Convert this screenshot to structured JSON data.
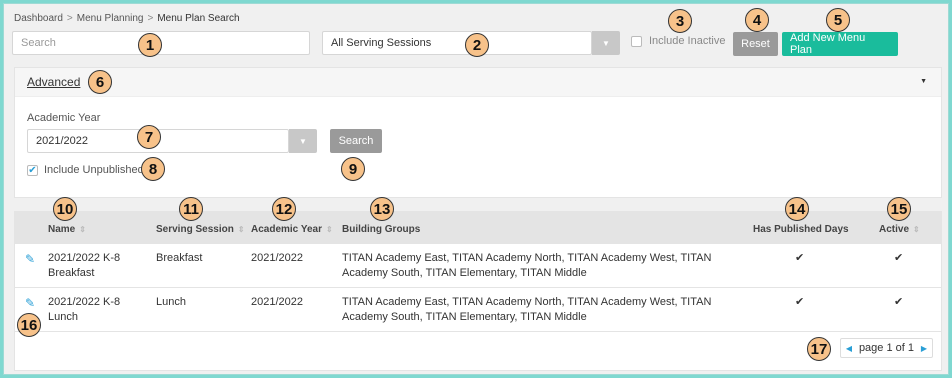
{
  "breadcrumb": [
    "Dashboard",
    "Menu Planning",
    "Menu Plan Search"
  ],
  "search": {
    "placeholder": "Search"
  },
  "serving_sessions": {
    "selected": "All Serving Sessions"
  },
  "include_inactive": {
    "label": "Include Inactive",
    "checked": false
  },
  "buttons": {
    "reset": "Reset",
    "add_new": "Add New Menu Plan",
    "search": "Search"
  },
  "advanced": {
    "label": "Advanced",
    "academic_year_label": "Academic Year",
    "academic_year_value": "2021/2022",
    "include_unpublished": "Include Unpublished",
    "include_unpublished_checked": true
  },
  "table": {
    "headers": [
      "Name",
      "Serving Session",
      "Academic Year",
      "Building Groups",
      "Has Published Days",
      "Active"
    ],
    "rows": [
      {
        "name_line1": "2021/2022 K-8",
        "name_line2": "Breakfast",
        "session": "Breakfast",
        "year": "2021/2022",
        "groups_line1": "TITAN Academy East, TITAN Academy North, TITAN Academy West, TITAN",
        "groups_line2": "Academy South, TITAN Elementary, TITAN Middle",
        "published": "✔",
        "active": "✔"
      },
      {
        "name_line1": "2021/2022 K-8",
        "name_line2": "Lunch",
        "session": "Lunch",
        "year": "2021/2022",
        "groups_line1": "TITAN Academy East, TITAN Academy North, TITAN Academy West, TITAN",
        "groups_line2": "Academy South, TITAN Elementary, TITAN Middle",
        "published": "✔",
        "active": "✔"
      }
    ]
  },
  "pager": {
    "text": "page 1 of 1"
  },
  "badges": [
    "1",
    "2",
    "3",
    "4",
    "5",
    "6",
    "7",
    "8",
    "9",
    "10",
    "11",
    "12",
    "13",
    "14",
    "15",
    "16",
    "17"
  ],
  "colors": {
    "teal": "#1abc9c",
    "reset": "#9a9a9a",
    "search_btn": "#9a9a9a",
    "link": "#2a9fd6"
  }
}
